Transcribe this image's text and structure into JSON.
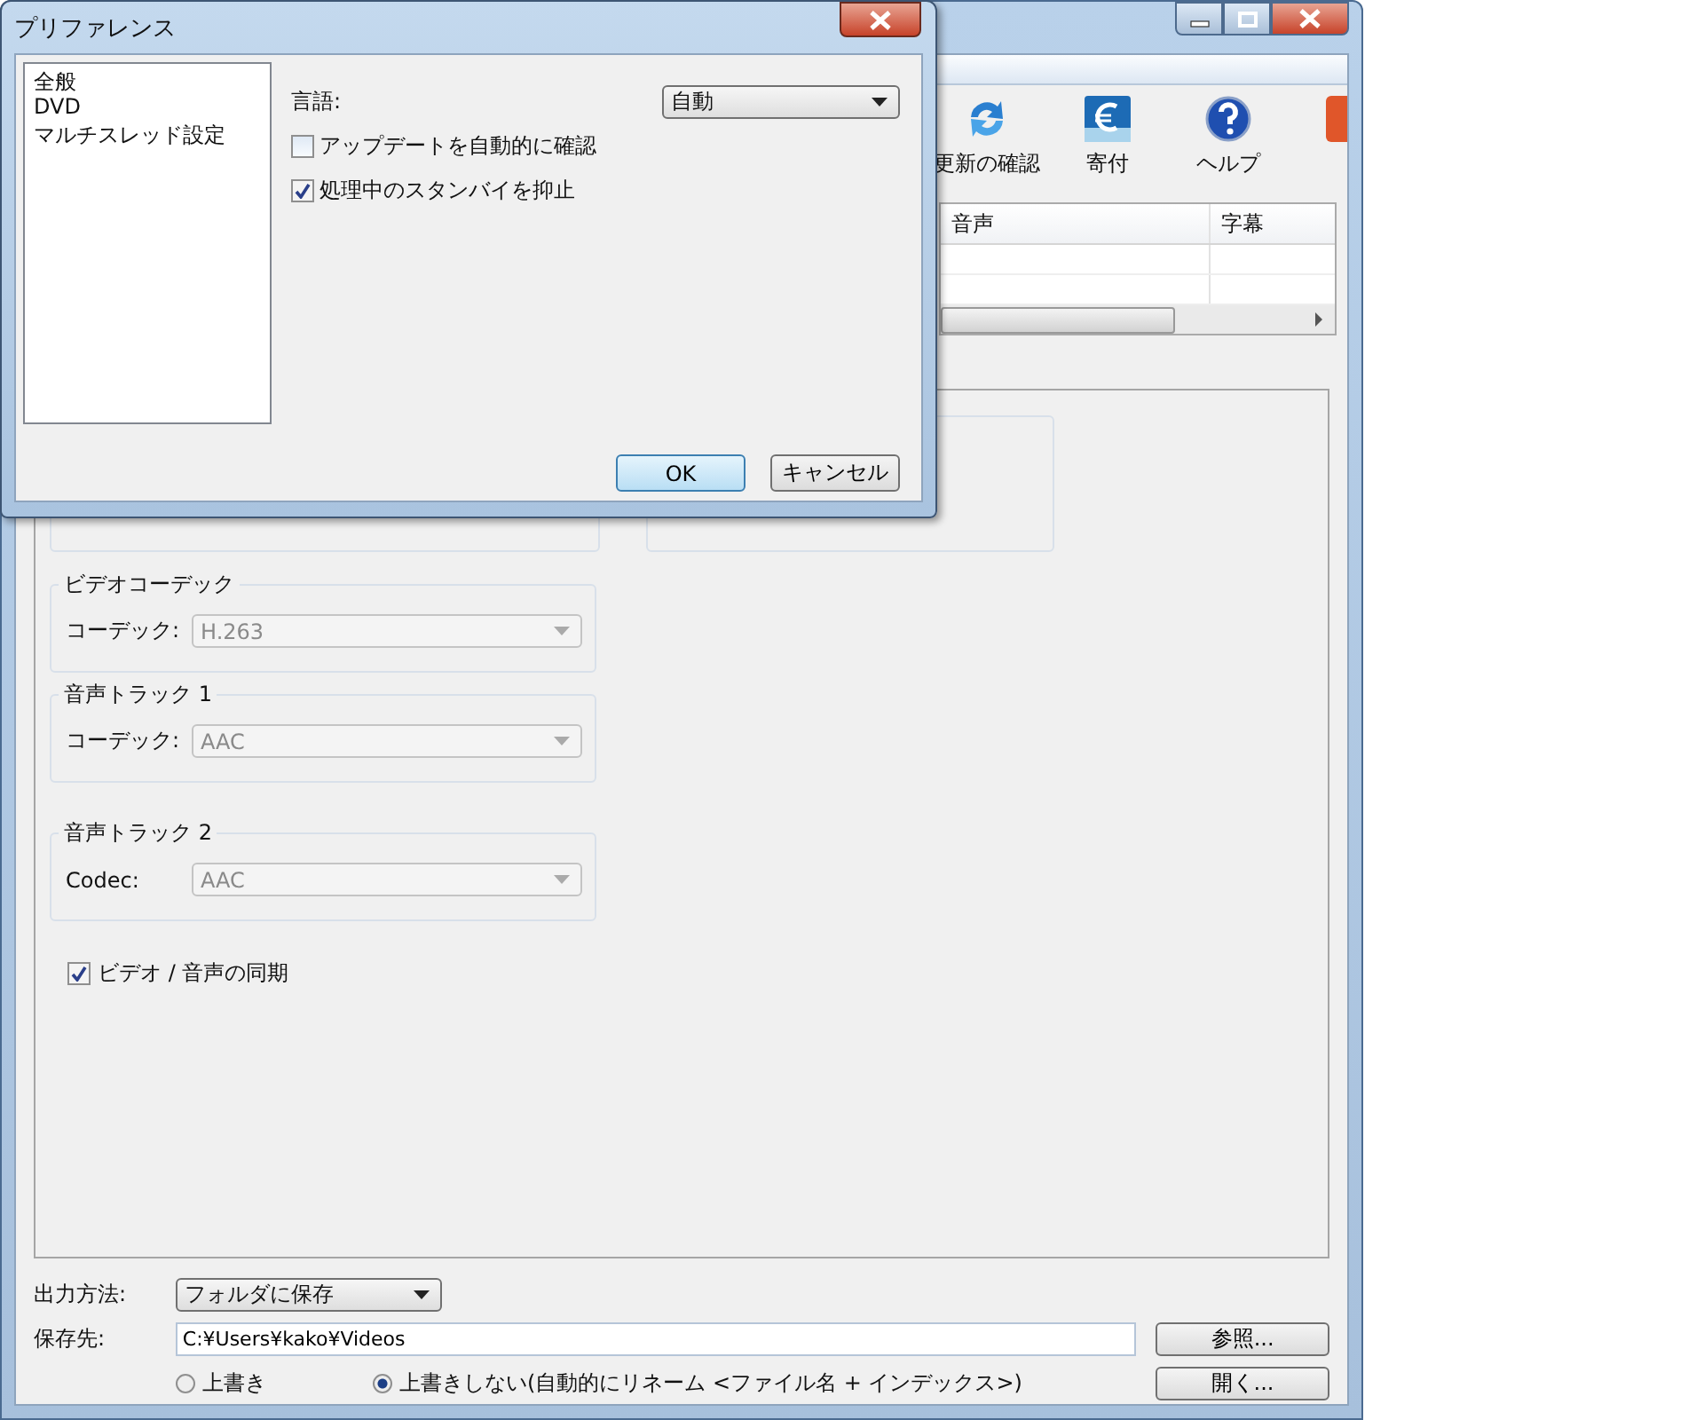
{
  "main_window": {
    "toolbar": [
      {
        "kind": "refresh",
        "label": "更新の確認"
      },
      {
        "kind": "donate",
        "label": "寄付"
      },
      {
        "kind": "help",
        "label": "ヘルプ"
      },
      {
        "kind": "cut"
      }
    ],
    "table": {
      "columns": [
        "音声",
        "字幕"
      ]
    },
    "groups": [
      {
        "title": "ビデオコーデック",
        "label": "コーデック:",
        "value": "H.263",
        "disabled": true
      },
      {
        "title": "音声トラック 1",
        "label": "コーデック:",
        "value": "AAC",
        "disabled": true
      },
      {
        "title": "音声トラック 2",
        "label": "Codec:",
        "value": "AAC",
        "disabled": true
      }
    ],
    "sync": {
      "label": "ビデオ / 音声の同期",
      "checked": true
    },
    "output": {
      "method_label": "出力方法:",
      "method_value": "フォルダに保存",
      "dest_label": "保存先:",
      "dest_value": "C:¥Users¥kako¥Videos",
      "browse_button": "参照...",
      "open_button": "開く...",
      "radios": [
        {
          "label": "上書き",
          "selected": false
        },
        {
          "label": "上書きしない(自動的にリネーム <ファイル名 + インデックス>)",
          "selected": true
        }
      ]
    }
  },
  "dialog": {
    "title": "プリファレンス",
    "categories": [
      "全般",
      "DVD",
      "マルチスレッド設定"
    ],
    "language_label": "言語:",
    "language_value": "自動",
    "checkboxes": [
      {
        "label": "アップデートを自動的に確認",
        "checked": false
      },
      {
        "label": "処理中のスタンバイを抑止",
        "checked": true
      }
    ],
    "buttons": [
      {
        "label": "OK",
        "default": true
      },
      {
        "label": "キャンセル",
        "default": false
      }
    ]
  }
}
